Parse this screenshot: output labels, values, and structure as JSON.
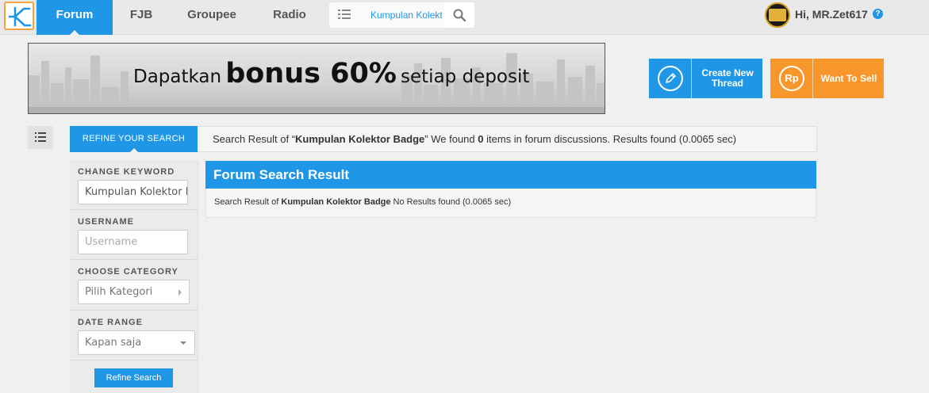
{
  "nav": {
    "items": [
      "Forum",
      "FJB",
      "Groupee",
      "Radio"
    ],
    "search_value": "Kumpulan Kolektor Badge",
    "greeting": "Hi, MR.Zet617",
    "logo_icon": "kaskus-k-logo",
    "accent_color": "#1f97e6"
  },
  "banner": {
    "prefix": "Dapatkan",
    "highlight": "bonus 60%",
    "suffix": "setiap deposit"
  },
  "actions": {
    "create_line1": "Create New",
    "create_line2": "Thread",
    "sell_label": "Want To Sell",
    "sell_icon_text": "Rp",
    "sell_color": "#f7962a"
  },
  "refine": {
    "tab_label": "REFINE YOUR SEARCH",
    "keyword_label": "CHANGE KEYWORD",
    "keyword_value": "Kumpulan Kolektor Badge",
    "username_label": "USERNAME",
    "username_placeholder": "Username",
    "category_label": "CHOOSE CATEGORY",
    "category_value": "Pilih Kategori",
    "date_label": "DATE RANGE",
    "date_value": "Kapan saja",
    "button_label": "Refine Search"
  },
  "summary": {
    "prefix": "Search Result of “",
    "query": "Kumpulan Kolektor Badge",
    "middle": "” We found ",
    "count": "0",
    "suffix": " items in forum discussions. Results found (0.0065 sec)"
  },
  "result": {
    "title": "Forum Search Result",
    "detail_prefix": "Search Result of ",
    "detail_query": "Kumpulan Kolektor Badge",
    "detail_suffix": " No Results found (0.0065 sec)"
  }
}
